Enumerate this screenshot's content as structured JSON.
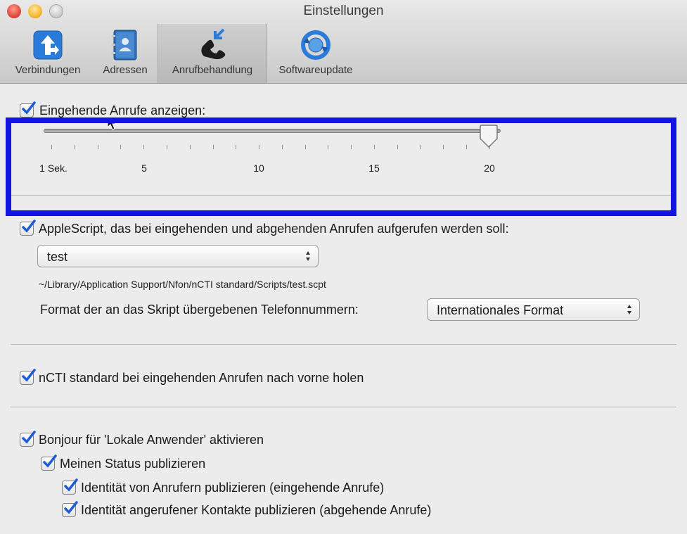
{
  "window": {
    "title": "Einstellungen"
  },
  "toolbar": {
    "tabs": [
      {
        "label": "Verbindungen",
        "icon": "routing-arrows-icon",
        "active": false
      },
      {
        "label": "Adressen",
        "icon": "address-book-icon",
        "active": false
      },
      {
        "label": "Anrufbehandlung",
        "icon": "phone-call-icon",
        "active": true
      },
      {
        "label": "Softwareupdate",
        "icon": "software-update-icon",
        "active": false
      }
    ]
  },
  "incoming_display": {
    "checked": true,
    "label": "Eingehende Anrufe anzeigen:",
    "slider": {
      "min": 1,
      "max": 20,
      "value": 20,
      "tick_labels": [
        "1 Sek.",
        "5",
        "10",
        "15",
        "20"
      ]
    }
  },
  "applescript": {
    "checked": true,
    "label": "AppleScript, das bei eingehenden und abgehenden Anrufen aufgerufen werden soll:",
    "script_select": "test",
    "script_path": "~/Library/Application Support/Nfon/nCTI standard/Scripts/test.scpt",
    "format_label": "Format der an das Skript übergebenen Telefonnummern:",
    "format_select": "Internationales Format"
  },
  "bring_front": {
    "checked": true,
    "label": "nCTI standard bei eingehenden Anrufen nach vorne holen"
  },
  "bonjour": {
    "checked": true,
    "label": "Bonjour für 'Lokale Anwender' aktivieren",
    "publish_status": {
      "checked": true,
      "label": "Meinen Status publizieren"
    },
    "publish_incoming": {
      "checked": true,
      "label": "Identität von Anrufern publizieren (eingehende Anrufe)"
    },
    "publish_outgoing": {
      "checked": true,
      "label": "Identität angerufener Kontakte publizieren (abgehende Anrufe)"
    }
  },
  "colors": {
    "highlight": "#1414e0",
    "checkmark": "#1e5bd6",
    "accent_icon": "#2b7bd8"
  }
}
